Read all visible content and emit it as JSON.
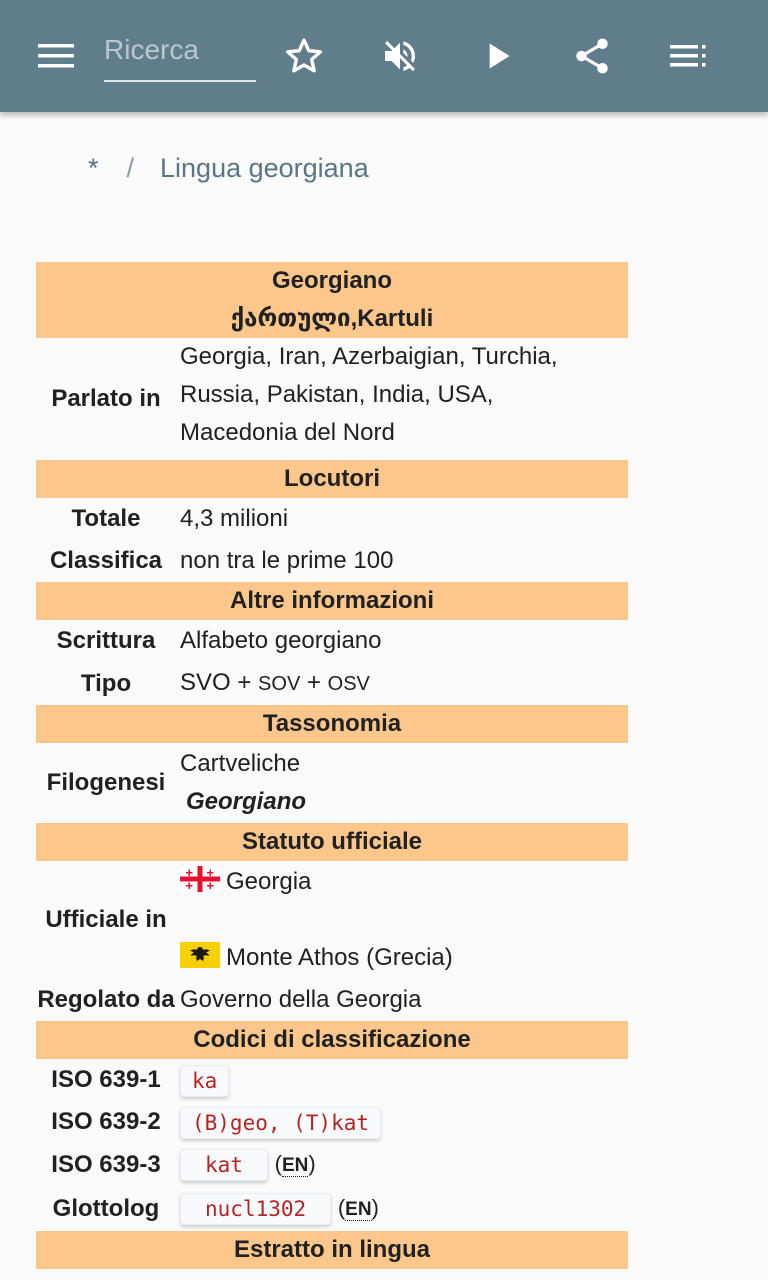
{
  "toolbar": {
    "search_placeholder": "Ricerca",
    "icons": [
      "menu-icon",
      "star-icon",
      "volume-off-icon",
      "play-icon",
      "share-icon",
      "toc-icon"
    ]
  },
  "breadcrumb": {
    "root": "*",
    "separator": "/",
    "current": "Lingua georgiana"
  },
  "infobox": {
    "title": "Georgiano",
    "native_name": "ქართული,Kartuli",
    "spoken_in_label": "Parlato in",
    "spoken_in_lines": [
      "Georgia, Iran, Azerbaigian, Turchia,",
      "Russia, Pakistan, India, USA,",
      "Macedonia del Nord"
    ],
    "speakers_header": "Locutori",
    "total_label": "Totale",
    "total_value": "4,3 milioni",
    "rank_label": "Classifica",
    "rank_value": "non tra le prime 100",
    "other_info_header": "Altre informazioni",
    "script_label": "Scrittura",
    "script_value": "Alfabeto georgiano",
    "type_label": "Tipo",
    "type_svo": "SVO",
    "type_plus": "+",
    "type_sov": "SOV",
    "type_osv": "OSV",
    "taxonomy_header": "Tassonomia",
    "phylogeny_label": "Filogenesi",
    "phylogeny_family": "Cartveliche",
    "phylogeny_language": "Georgiano",
    "official_status_header": "Statuto ufficiale",
    "official_in_label": "Ufficiale in",
    "official_place_1": "Georgia",
    "official_place_2": "Monte Athos (Grecia)",
    "regulated_label": "Regolato da",
    "regulated_value": "Governo della Georgia",
    "codes_header": "Codici di classificazione",
    "iso1_label": "ISO 639-1",
    "iso1_value": "ka",
    "iso2_label": "ISO 639-2",
    "iso2_value": "(B)geo, (T)kat",
    "iso3_label": "ISO 639-3",
    "iso3_value": "kat",
    "glottolog_label": "Glottolog",
    "glottolog_value": "nucl1302",
    "en_tag": "EN",
    "excerpt_header": "Estratto in lingua"
  },
  "colors": {
    "appbar": "#607d8b",
    "infobox_header": "#fdc78c",
    "code_text": "#b32424"
  }
}
